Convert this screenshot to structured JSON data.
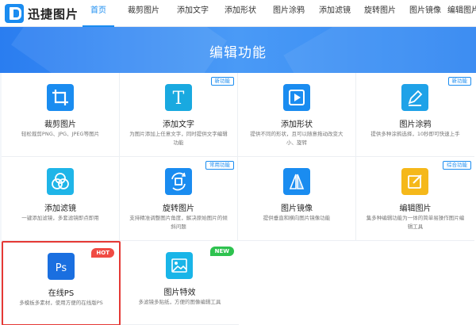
{
  "app": {
    "logo_text": "迅捷图片"
  },
  "nav": {
    "items": [
      {
        "label": "首页",
        "active": true
      },
      {
        "label": "裁剪图片",
        "active": false
      },
      {
        "label": "添加文字",
        "active": false
      },
      {
        "label": "添加形状",
        "active": false
      },
      {
        "label": "图片涂鸦",
        "active": false
      },
      {
        "label": "添加滤镜",
        "active": false
      },
      {
        "label": "旋转图片",
        "active": false
      },
      {
        "label": "图片镜像",
        "active": false
      },
      {
        "label": "编辑图片",
        "active": false
      }
    ]
  },
  "banner": {
    "title": "编辑功能"
  },
  "features": [
    {
      "title": "裁剪图片",
      "desc": "轻松裁剪PNG、JPG、JPEG等图片",
      "badge": "",
      "icon": "crop-icon",
      "color": "#1a8cf0"
    },
    {
      "title": "添加文字",
      "desc": "为图片添加上任意文字，同时提供文字编辑功能",
      "badge": "新功能",
      "icon": "text-icon",
      "color": "#19a9e0"
    },
    {
      "title": "添加形状",
      "desc": "提供不同的形状，且可以随意拖动改变大小、旋转",
      "badge": "",
      "icon": "shape-icon",
      "color": "#1a8cf0"
    },
    {
      "title": "图片涂鸦",
      "desc": "提供多种涂鸦选择，10秒即可快速上手",
      "badge": "新功能",
      "icon": "pen-icon",
      "color": "#1fa2e8"
    },
    {
      "title": "添加滤镜",
      "desc": "一键添加滤镜，多套滤镜即点即用",
      "badge": "",
      "icon": "filter-icon",
      "color": "#1fb5e8"
    },
    {
      "title": "旋转图片",
      "desc": "支持精准调整图片角度，解决原始图片的倾斜问题",
      "badge": "常用功能",
      "icon": "rotate-icon",
      "color": "#1a8cf0"
    },
    {
      "title": "图片镜像",
      "desc": "提供垂直和横向图片镜像功能",
      "badge": "",
      "icon": "mirror-icon",
      "color": "#1a8cf0"
    },
    {
      "title": "编辑图片",
      "desc": "集多种编辑功能为一体的简单易操作图片编辑工具",
      "badge": "综合功能",
      "icon": "edit-icon",
      "color": "#f5b81a"
    },
    {
      "title": "在线PS",
      "desc": "多模板多素材，使用方便的在线版PS",
      "badge_hot": "HOT",
      "icon": "ps-icon",
      "color": "#1a6fe0"
    },
    {
      "title": "图片特效",
      "desc": "多滤镜多贴纸，方便的图像编辑工具",
      "badge_new": "NEW",
      "icon": "image-effect-icon",
      "color": "#19b5e8"
    }
  ]
}
